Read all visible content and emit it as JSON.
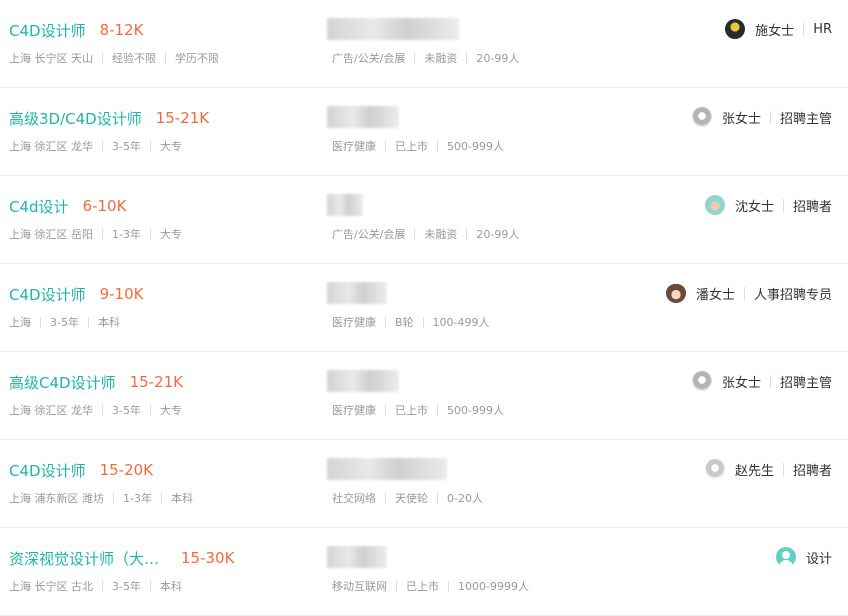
{
  "jobs": [
    {
      "title": "C4D设计师",
      "salary": "8-12K",
      "location": "上海 长宁区 天山",
      "experience": "经验不限",
      "education": "学历不限",
      "industry": "广告/公关/会展",
      "funding": "未融资",
      "size": "20-99人",
      "recruiter_name": "施女士",
      "recruiter_title": "HR",
      "avatar_icon": "avatar-dark-icon"
    },
    {
      "title": "高级3D/C4D设计师",
      "salary": "15-21K",
      "location": "上海 徐汇区 龙华",
      "experience": "3-5年",
      "education": "大专",
      "industry": "医疗健康",
      "funding": "已上市",
      "size": "500-999人",
      "recruiter_name": "张女士",
      "recruiter_title": "招聘主管",
      "avatar_icon": "avatar-gray-icon"
    },
    {
      "title": "C4d设计",
      "salary": "6-10K",
      "location": "上海 徐汇区 岳阳",
      "experience": "1-3年",
      "education": "大专",
      "industry": "广告/公关/会展",
      "funding": "未融资",
      "size": "20-99人",
      "recruiter_name": "沈女士",
      "recruiter_title": "招聘者",
      "avatar_icon": "avatar-teal-icon"
    },
    {
      "title": "C4D设计师",
      "salary": "9-10K",
      "location": "上海",
      "experience": "3-5年",
      "education": "本科",
      "industry": "医疗健康",
      "funding": "B轮",
      "size": "100-499人",
      "recruiter_name": "潘女士",
      "recruiter_title": "人事招聘专员",
      "avatar_icon": "avatar-girl-icon"
    },
    {
      "title": "高级C4D设计师",
      "salary": "15-21K",
      "location": "上海 徐汇区 龙华",
      "experience": "3-5年",
      "education": "大专",
      "industry": "医疗健康",
      "funding": "已上市",
      "size": "500-999人",
      "recruiter_name": "张女士",
      "recruiter_title": "招聘主管",
      "avatar_icon": "avatar-gray-icon"
    },
    {
      "title": "C4D设计师",
      "salary": "15-20K",
      "location": "上海 浦东新区 潍坊",
      "experience": "1-3年",
      "education": "本科",
      "industry": "社交网络",
      "funding": "天使轮",
      "size": "0-20人",
      "recruiter_name": "赵先生",
      "recruiter_title": "招聘者",
      "avatar_icon": "avatar-light-icon"
    },
    {
      "title": "资深视觉设计师（大…",
      "salary": "15-30K",
      "location": "上海 长宁区 古北",
      "experience": "3-5年",
      "education": "本科",
      "industry": "移动互联网",
      "funding": "已上市",
      "size": "1000-9999人",
      "recruiter_name": "设计",
      "recruiter_title": "",
      "avatar_icon": "avatar-default-icon"
    }
  ]
}
